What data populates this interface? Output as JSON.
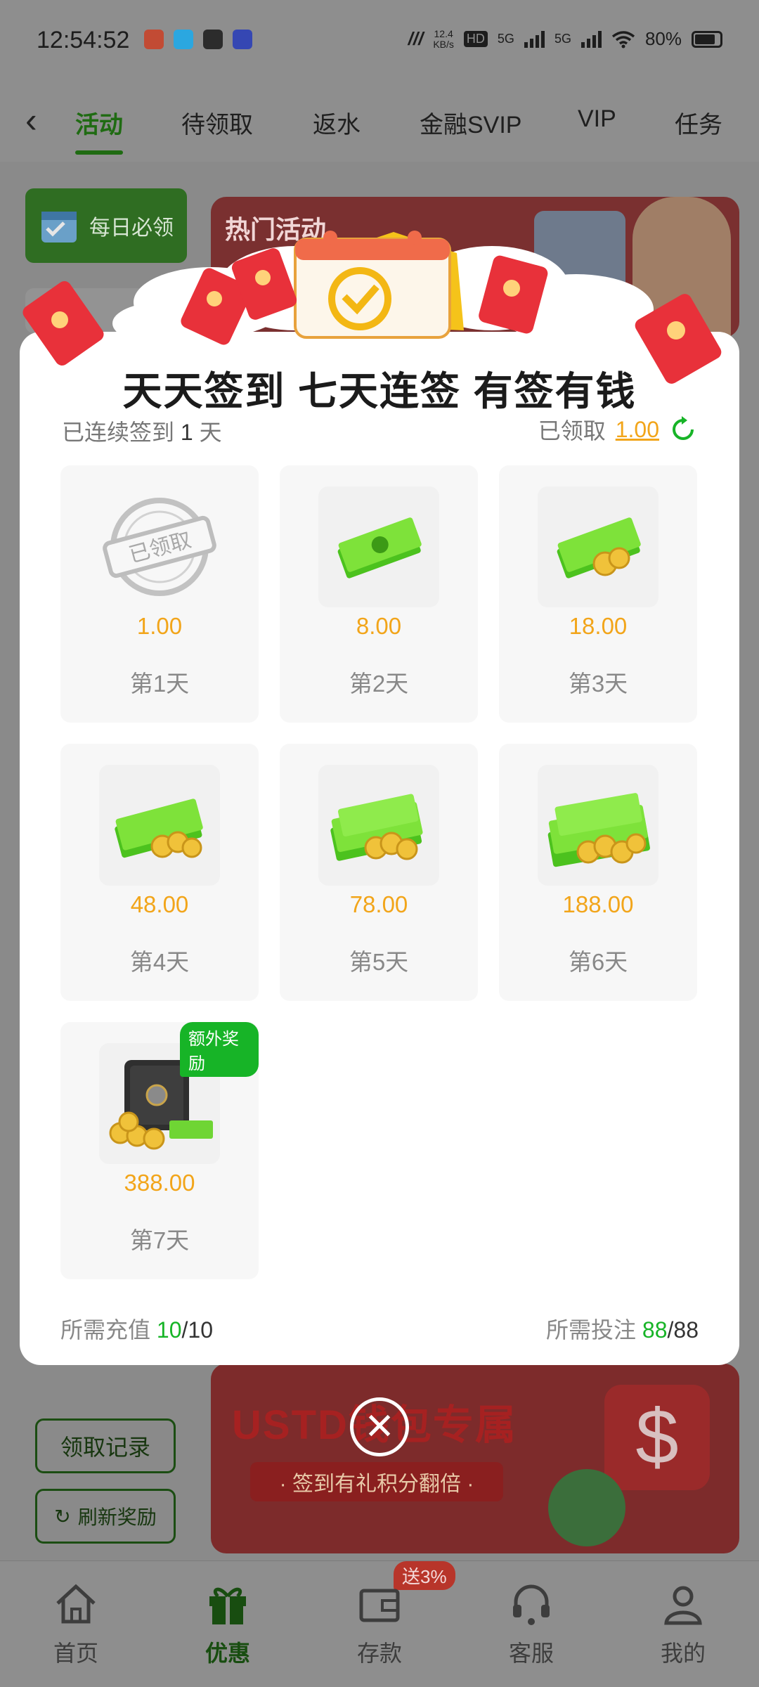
{
  "status_bar": {
    "time": "12:54:52",
    "speed_top": "12.4",
    "speed_bottom": "KB/s",
    "hd": "HD",
    "net1": "5G",
    "net2": "5G",
    "battery": "80%"
  },
  "tabs": [
    {
      "label": "活动",
      "active": true
    },
    {
      "label": "待领取"
    },
    {
      "label": "返水"
    },
    {
      "label": "金融SVIP"
    },
    {
      "label": "VIP"
    },
    {
      "label": "任务"
    }
  ],
  "background": {
    "daily_button": "每日必领",
    "banner_top_label": "热门活动",
    "banner_bottom_title": "USTD钱包专属",
    "banner_bottom_sub": "· 签到有礼积分翻倍 ·",
    "records_button": "领取记录",
    "refresh_button": "刷新奖励"
  },
  "modal": {
    "title": "天天签到 七天连签 有签有钱",
    "streak_prefix": "已连续签到",
    "streak_days": "1",
    "streak_suffix": "天",
    "claimed_label": "已领取",
    "claimed_amount": "1.00",
    "claimed_stamp": "已领取",
    "bonus_tag": "额外奖励",
    "days": [
      {
        "amount": "1.00",
        "label": "第1天",
        "claimed": true
      },
      {
        "amount": "8.00",
        "label": "第2天"
      },
      {
        "amount": "18.00",
        "label": "第3天"
      },
      {
        "amount": "48.00",
        "label": "第4天"
      },
      {
        "amount": "78.00",
        "label": "第5天"
      },
      {
        "amount": "188.00",
        "label": "第6天"
      },
      {
        "amount": "388.00",
        "label": "第7天",
        "bonus": true
      }
    ],
    "deposit_label": "所需充值",
    "deposit_done": "10",
    "deposit_total": "/10",
    "bet_label": "所需投注",
    "bet_done": "88",
    "bet_total": "/88"
  },
  "bottom_nav": [
    {
      "label": "首页",
      "icon": "home-icon"
    },
    {
      "label": "优惠",
      "icon": "gift-icon",
      "active": true
    },
    {
      "label": "存款",
      "icon": "wallet-icon"
    },
    {
      "label": "客服",
      "icon": "headset-icon"
    },
    {
      "label": "我的",
      "icon": "user-icon"
    }
  ],
  "deposit_badge": "送3%",
  "colors": {
    "accent_green": "#17b427",
    "amount_gold": "#f2a51a",
    "brand_dark_green": "#1f6b12"
  }
}
